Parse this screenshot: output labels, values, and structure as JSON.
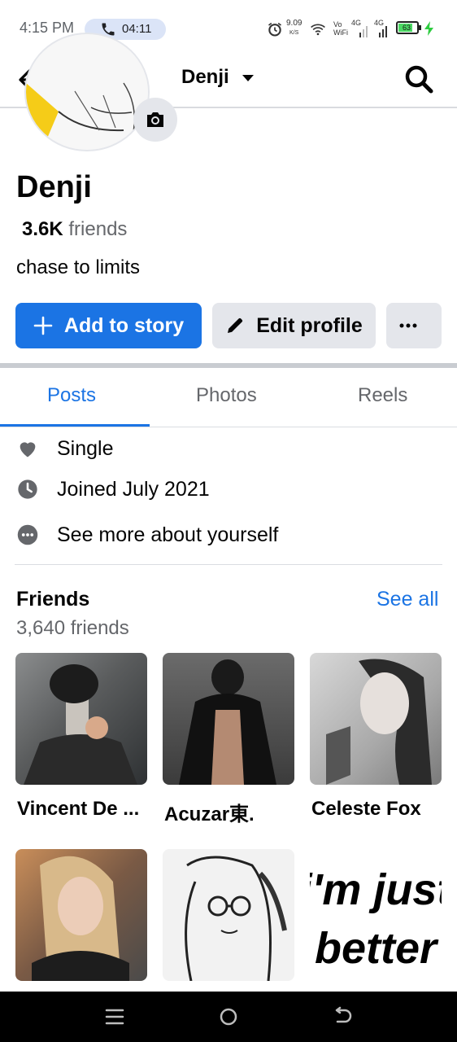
{
  "status_bar": {
    "time": "4:15 PM",
    "call_timer": "04:11",
    "speed_value": "9.09",
    "speed_unit": "K/S",
    "vowifi_top": "Vo",
    "vowifi_bottom": "WiFi",
    "net1": "4G",
    "net2": "4G",
    "battery": "63"
  },
  "header": {
    "title": "Denji"
  },
  "profile": {
    "name": "Denji",
    "friends_count": "3.6K",
    "friends_word": "friends",
    "bio": "chase to limits"
  },
  "actions": {
    "add_story": "Add to story",
    "edit_profile": "Edit profile"
  },
  "tabs": [
    "Posts",
    "Photos",
    "Reels"
  ],
  "intro": [
    {
      "icon": "heart-icon",
      "text": "Single"
    },
    {
      "icon": "clock-icon",
      "text": "Joined July 2021"
    },
    {
      "icon": "more-dots-icon",
      "text": "See more about yourself"
    }
  ],
  "friends_section": {
    "title": "Friends",
    "see_all": "See all",
    "total": "3,640 friends",
    "friends": [
      {
        "name": "Vincent De ..."
      },
      {
        "name": "Acuzar東."
      },
      {
        "name": "Celeste Fox"
      },
      {
        "name": ""
      },
      {
        "name": ""
      },
      {
        "name": ""
      }
    ],
    "tile_text": [
      "i'm just",
      "better"
    ]
  },
  "colors": {
    "accent": "#1b74e4",
    "secondary_button": "#e4e6eb",
    "muted_text": "#65676b",
    "nav_bar": "#000000"
  }
}
